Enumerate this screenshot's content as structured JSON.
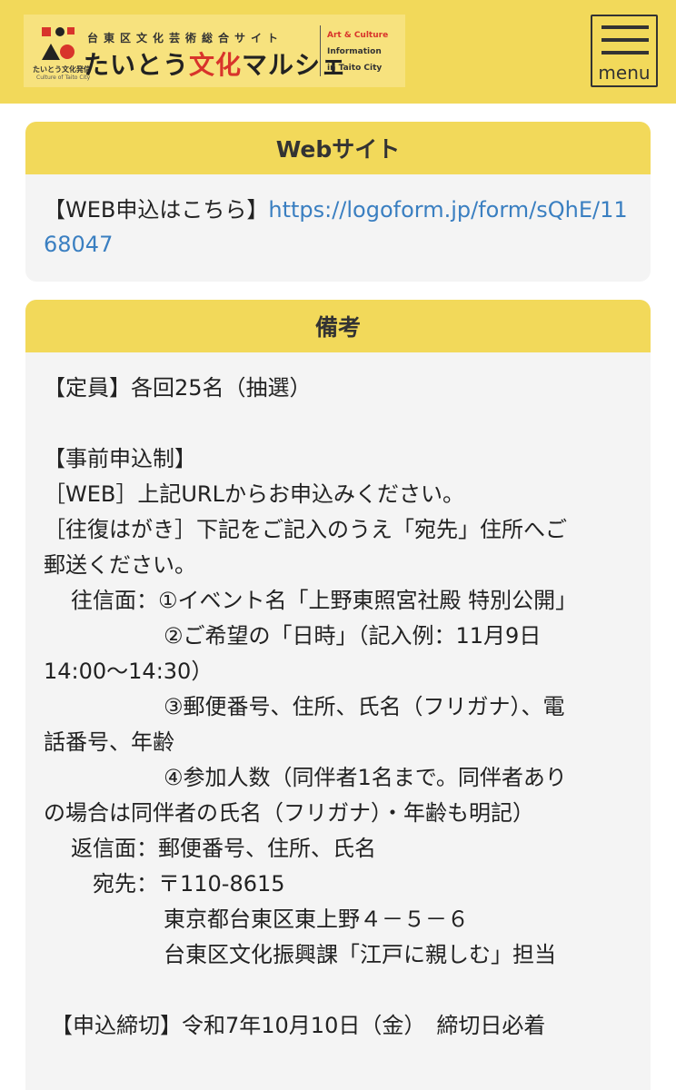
{
  "header": {
    "logo": {
      "tagline": "台東区文化芸術総合サイト",
      "title_part1": "たいとう",
      "title_accent": "文化",
      "title_part2": "マルシェ",
      "small_text": "たいとう文化発信",
      "small_text_en": "Culture of Taito City",
      "en_line1": "Art & Culture",
      "en_line2": "Information",
      "en_line3": "in Taito City"
    },
    "menu_label": "menu"
  },
  "colors": {
    "header_bg": "#f2d95a",
    "card_head_bg": "#f2d95a",
    "card_body_bg": "#f4f4f4",
    "link": "#3a7fc1",
    "accent_red": "#d8342b"
  },
  "website_section": {
    "title": "Webサイト",
    "prefix": "【WEB申込はこちら】",
    "url": "https://logoform.jp/form/sQhE/1168047"
  },
  "notes_section": {
    "title": "備考",
    "capacity": "【定員】各回25名（抽選）",
    "reservation_heading": "【事前申込制】",
    "web_line": "［WEB］上記URLからお申込みください。",
    "postcard_line1": "［往復はがき］下記をご記入のうえ「宛先」住所へご",
    "postcard_line2": "郵送ください。",
    "reply_item1": "往信面：①イベント名「上野東照宮社殿 特別公開」",
    "reply_item2a": "②ご希望の「日時」（記入例：11月9日",
    "reply_item2b": "14:00〜14:30）",
    "reply_item3a": "③郵便番号、住所、氏名（フリガナ）、電",
    "reply_item3b": "話番号、年齢",
    "reply_item4a": "④参加人数（同伴者1名まで。同伴者あり",
    "reply_item4b": "の場合は同伴者の氏名（フリガナ）・年齢も明記）",
    "return_side": "返信面：郵便番号、住所、氏名",
    "address_label": "宛先：〒110-8615",
    "address_line1": "東京都台東区東上野４－５－６",
    "address_line2": "台東区文化振興課「江戸に親しむ」担当",
    "deadline": "【申込締切】令和7年10月10日（金）　締切日必着"
  }
}
